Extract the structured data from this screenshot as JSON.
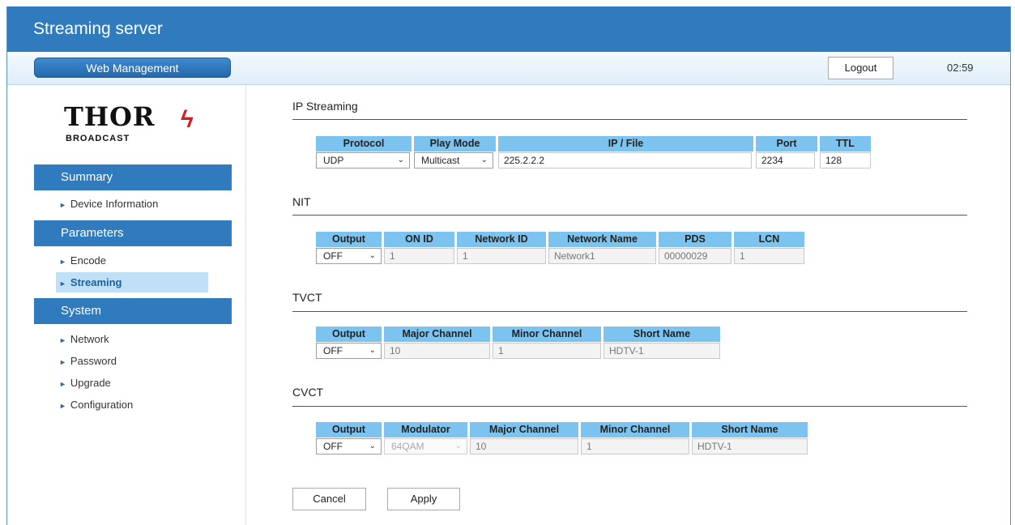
{
  "header": {
    "title": "Streaming server"
  },
  "nav": {
    "web_management": "Web Management",
    "logout": "Logout",
    "clock": "02:59"
  },
  "logo": {
    "main": "THOR",
    "sub": "BROADCAST"
  },
  "sidebar": {
    "summary": {
      "label": "Summary",
      "items": [
        "Device Information"
      ]
    },
    "parameters": {
      "label": "Parameters",
      "items": [
        "Encode",
        "Streaming"
      ]
    },
    "system": {
      "label": "System",
      "items": [
        "Network",
        "Password",
        "Upgrade",
        "Configuration"
      ]
    },
    "active_item": "Streaming"
  },
  "ip_streaming": {
    "title": "IP Streaming",
    "headers": [
      "Protocol",
      "Play Mode",
      "IP / File",
      "Port",
      "TTL"
    ],
    "protocol": "UDP",
    "play_mode": "Multicast",
    "ip_file": "225.2.2.2",
    "port": "2234",
    "ttl": "128"
  },
  "nit": {
    "title": "NIT",
    "headers": [
      "Output",
      "ON ID",
      "Network ID",
      "Network Name",
      "PDS",
      "LCN"
    ],
    "output": "OFF",
    "on_id": "1",
    "network_id": "1",
    "network_name": "Network1",
    "pds": "00000029",
    "lcn": "1"
  },
  "tvct": {
    "title": "TVCT",
    "headers": [
      "Output",
      "Major Channel",
      "Minor Channel",
      "Short Name"
    ],
    "output": "OFF",
    "major_channel": "10",
    "minor_channel": "1",
    "short_name": "HDTV-1"
  },
  "cvct": {
    "title": "CVCT",
    "headers": [
      "Output",
      "Modulator",
      "Major Channel",
      "Minor Channel",
      "Short Name"
    ],
    "output": "OFF",
    "modulator": "64QAM",
    "major_channel": "10",
    "minor_channel": "1",
    "short_name": "HDTV-1"
  },
  "buttons": {
    "cancel": "Cancel",
    "apply": "Apply"
  },
  "colors": {
    "header_blue": "#2f7bbd",
    "table_header": "#7cc4ef",
    "active_item_bg": "#bfe0f7"
  }
}
